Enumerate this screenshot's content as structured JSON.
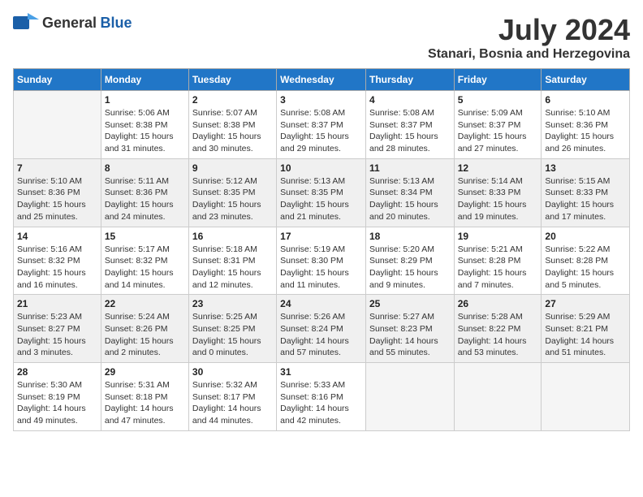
{
  "logo": {
    "general": "General",
    "blue": "Blue"
  },
  "title": "July 2024",
  "subtitle": "Stanari, Bosnia and Herzegovina",
  "days_of_week": [
    "Sunday",
    "Monday",
    "Tuesday",
    "Wednesday",
    "Thursday",
    "Friday",
    "Saturday"
  ],
  "weeks": [
    [
      {
        "day": "",
        "empty": true
      },
      {
        "day": "1",
        "sunrise": "5:06 AM",
        "sunset": "8:38 PM",
        "daylight": "15 hours and 31 minutes."
      },
      {
        "day": "2",
        "sunrise": "5:07 AM",
        "sunset": "8:38 PM",
        "daylight": "15 hours and 30 minutes."
      },
      {
        "day": "3",
        "sunrise": "5:08 AM",
        "sunset": "8:37 PM",
        "daylight": "15 hours and 29 minutes."
      },
      {
        "day": "4",
        "sunrise": "5:08 AM",
        "sunset": "8:37 PM",
        "daylight": "15 hours and 28 minutes."
      },
      {
        "day": "5",
        "sunrise": "5:09 AM",
        "sunset": "8:37 PM",
        "daylight": "15 hours and 27 minutes."
      },
      {
        "day": "6",
        "sunrise": "5:10 AM",
        "sunset": "8:36 PM",
        "daylight": "15 hours and 26 minutes."
      }
    ],
    [
      {
        "day": "7",
        "sunrise": "5:10 AM",
        "sunset": "8:36 PM",
        "daylight": "15 hours and 25 minutes."
      },
      {
        "day": "8",
        "sunrise": "5:11 AM",
        "sunset": "8:36 PM",
        "daylight": "15 hours and 24 minutes."
      },
      {
        "day": "9",
        "sunrise": "5:12 AM",
        "sunset": "8:35 PM",
        "daylight": "15 hours and 23 minutes."
      },
      {
        "day": "10",
        "sunrise": "5:13 AM",
        "sunset": "8:35 PM",
        "daylight": "15 hours and 21 minutes."
      },
      {
        "day": "11",
        "sunrise": "5:13 AM",
        "sunset": "8:34 PM",
        "daylight": "15 hours and 20 minutes."
      },
      {
        "day": "12",
        "sunrise": "5:14 AM",
        "sunset": "8:33 PM",
        "daylight": "15 hours and 19 minutes."
      },
      {
        "day": "13",
        "sunrise": "5:15 AM",
        "sunset": "8:33 PM",
        "daylight": "15 hours and 17 minutes."
      }
    ],
    [
      {
        "day": "14",
        "sunrise": "5:16 AM",
        "sunset": "8:32 PM",
        "daylight": "15 hours and 16 minutes."
      },
      {
        "day": "15",
        "sunrise": "5:17 AM",
        "sunset": "8:32 PM",
        "daylight": "15 hours and 14 minutes."
      },
      {
        "day": "16",
        "sunrise": "5:18 AM",
        "sunset": "8:31 PM",
        "daylight": "15 hours and 12 minutes."
      },
      {
        "day": "17",
        "sunrise": "5:19 AM",
        "sunset": "8:30 PM",
        "daylight": "15 hours and 11 minutes."
      },
      {
        "day": "18",
        "sunrise": "5:20 AM",
        "sunset": "8:29 PM",
        "daylight": "15 hours and 9 minutes."
      },
      {
        "day": "19",
        "sunrise": "5:21 AM",
        "sunset": "8:28 PM",
        "daylight": "15 hours and 7 minutes."
      },
      {
        "day": "20",
        "sunrise": "5:22 AM",
        "sunset": "8:28 PM",
        "daylight": "15 hours and 5 minutes."
      }
    ],
    [
      {
        "day": "21",
        "sunrise": "5:23 AM",
        "sunset": "8:27 PM",
        "daylight": "15 hours and 3 minutes."
      },
      {
        "day": "22",
        "sunrise": "5:24 AM",
        "sunset": "8:26 PM",
        "daylight": "15 hours and 2 minutes."
      },
      {
        "day": "23",
        "sunrise": "5:25 AM",
        "sunset": "8:25 PM",
        "daylight": "15 hours and 0 minutes."
      },
      {
        "day": "24",
        "sunrise": "5:26 AM",
        "sunset": "8:24 PM",
        "daylight": "14 hours and 57 minutes."
      },
      {
        "day": "25",
        "sunrise": "5:27 AM",
        "sunset": "8:23 PM",
        "daylight": "14 hours and 55 minutes."
      },
      {
        "day": "26",
        "sunrise": "5:28 AM",
        "sunset": "8:22 PM",
        "daylight": "14 hours and 53 minutes."
      },
      {
        "day": "27",
        "sunrise": "5:29 AM",
        "sunset": "8:21 PM",
        "daylight": "14 hours and 51 minutes."
      }
    ],
    [
      {
        "day": "28",
        "sunrise": "5:30 AM",
        "sunset": "8:19 PM",
        "daylight": "14 hours and 49 minutes."
      },
      {
        "day": "29",
        "sunrise": "5:31 AM",
        "sunset": "8:18 PM",
        "daylight": "14 hours and 47 minutes."
      },
      {
        "day": "30",
        "sunrise": "5:32 AM",
        "sunset": "8:17 PM",
        "daylight": "14 hours and 44 minutes."
      },
      {
        "day": "31",
        "sunrise": "5:33 AM",
        "sunset": "8:16 PM",
        "daylight": "14 hours and 42 minutes."
      },
      {
        "day": "",
        "empty": true
      },
      {
        "day": "",
        "empty": true
      },
      {
        "day": "",
        "empty": true
      }
    ]
  ]
}
